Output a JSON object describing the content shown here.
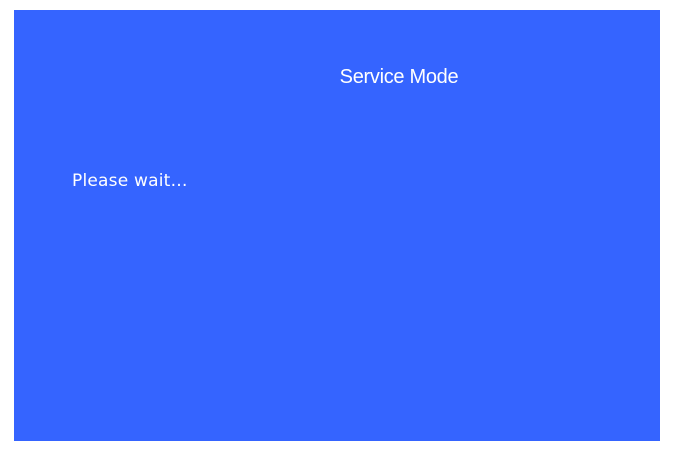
{
  "screen": {
    "title": "Service Mode",
    "status_message": "Please wait…",
    "background_color": "#3564ff",
    "text_color": "#ffffff"
  }
}
